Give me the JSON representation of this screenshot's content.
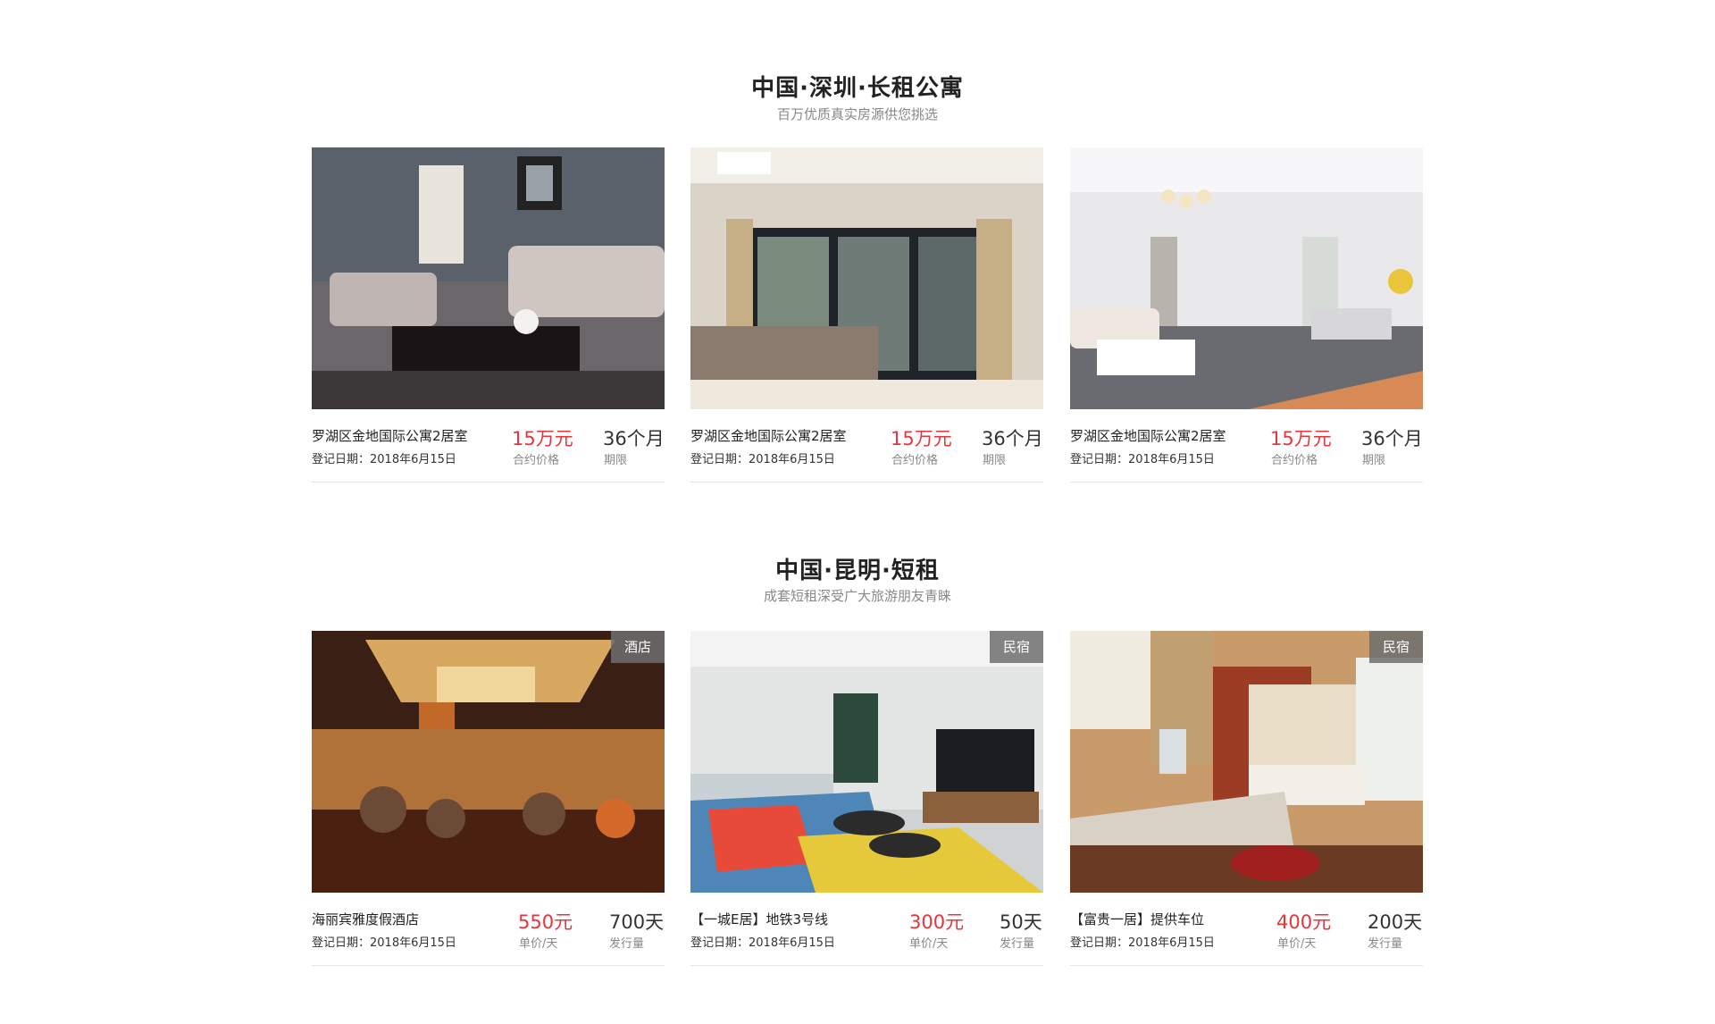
{
  "section1": {
    "title": "中国·深圳·长租公寓",
    "subtitle": "百万优质真实房源供您挑选",
    "cards": [
      {
        "name": "罗湖区金地国际公寓2居室",
        "date_label": "登记日期：",
        "date": "2018年6月15日",
        "price": "15万元",
        "price_label": "合约价格",
        "term": "36个月",
        "term_label": "期限"
      },
      {
        "name": "罗湖区金地国际公寓2居室",
        "date_label": "登记日期：",
        "date": "2018年6月15日",
        "price": "15万元",
        "price_label": "合约价格",
        "term": "36个月",
        "term_label": "期限"
      },
      {
        "name": "罗湖区金地国际公寓2居室",
        "date_label": "登记日期：",
        "date": "2018年6月15日",
        "price": "15万元",
        "price_label": "合约价格",
        "term": "36个月",
        "term_label": "期限"
      }
    ]
  },
  "section2": {
    "title": "中国·昆明·短租",
    "subtitle": "成套短租深受广大旅游朋友青睐",
    "cards": [
      {
        "tag": "酒店",
        "name": "海丽宾雅度假酒店",
        "date_label": "登记日期：",
        "date": "2018年6月15日",
        "price": "550元",
        "price_label": "单价/天",
        "term": "700天",
        "term_label": "发行量"
      },
      {
        "tag": "民宿",
        "name": "【一城E居】地铁3号线",
        "date_label": "登记日期：",
        "date": "2018年6月15日",
        "price": "300元",
        "price_label": "单价/天",
        "term": "50天",
        "term_label": "发行量"
      },
      {
        "tag": "民宿",
        "name": "【富贵一居】提供车位",
        "date_label": "登记日期：",
        "date": "2018年6月15日",
        "price": "400元",
        "price_label": "单价/天",
        "term": "200天",
        "term_label": "发行量"
      }
    ]
  },
  "colors": {
    "price": "#e8353b",
    "title": "#222222",
    "subtitle": "#888888",
    "tag_bg": "#6e6e6e"
  }
}
